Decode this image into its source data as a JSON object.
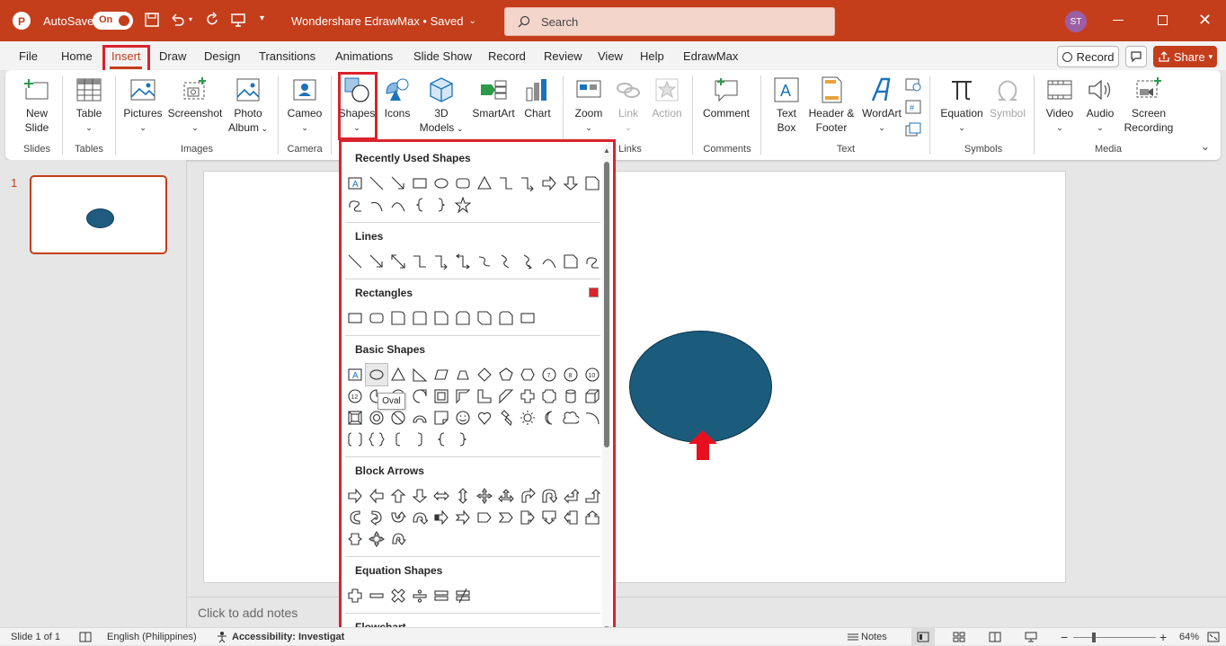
{
  "titlebar": {
    "autosave_label": "AutoSave",
    "autosave_state": "On",
    "doc_title": "Wondershare EdrawMax • Saved",
    "search_placeholder": "Search",
    "user_initials": "ST",
    "brand_color": "#c43e1c"
  },
  "tabs": {
    "items": [
      "File",
      "Home",
      "Insert",
      "Draw",
      "Design",
      "Transitions",
      "Animations",
      "Slide Show",
      "Record",
      "Review",
      "View",
      "Help",
      "EdrawMax"
    ],
    "active": "Insert",
    "record_label": "Record",
    "share_label": "Share"
  },
  "ribbon": {
    "buttons": {
      "new_slide": "New Slide",
      "table": "Table",
      "pictures": "Pictures",
      "screenshot": "Screenshot",
      "photo_album": "Photo Album",
      "cameo": "Cameo",
      "shapes": "Shapes",
      "icons": "Icons",
      "models_3d": "3D Models",
      "smartart": "SmartArt",
      "chart": "Chart",
      "zoom": "Zoom",
      "link": "Link",
      "action": "Action",
      "comment": "Comment",
      "text_box": "Text Box",
      "header_footer": "Header & Footer",
      "wordart": "WordArt",
      "equation": "Equation",
      "symbol": "Symbol",
      "video": "Video",
      "audio": "Audio",
      "screen_recording": "Screen Recording"
    },
    "groups": {
      "slides": "Slides",
      "tables": "Tables",
      "images": "Images",
      "camera": "Camera",
      "links": "Links",
      "comments": "Comments",
      "text": "Text",
      "symbols": "Symbols",
      "media": "Media"
    }
  },
  "gallery": {
    "sections": {
      "recent": "Recently Used Shapes",
      "lines": "Lines",
      "rectangles": "Rectangles",
      "basic": "Basic Shapes",
      "block_arrows": "Block Arrows",
      "equation": "Equation Shapes",
      "flowchart": "Flowchart"
    },
    "tooltip": "Oval"
  },
  "slides_pane": {
    "slide_number": "1"
  },
  "notes_placeholder": "Click to add notes",
  "statusbar": {
    "slide_info": "Slide 1 of 1",
    "language": "English (Philippines)",
    "accessibility": "Accessibility: Investigat",
    "notes": "Notes",
    "zoom": "64%"
  },
  "colors": {
    "highlight_red": "#d9232d",
    "oval_fill": "#1b5c7c",
    "arrow_red": "#e8101e"
  }
}
